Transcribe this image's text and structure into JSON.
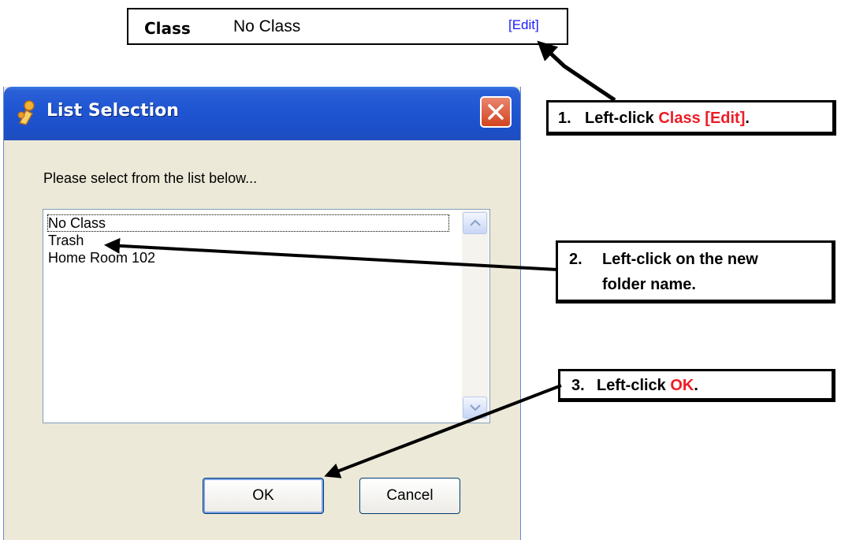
{
  "class_field": {
    "label": "Class",
    "value": "No Class",
    "edit": "[Edit]"
  },
  "dialog": {
    "title": "List Selection",
    "prompt": "Please select from the list below...",
    "items": [
      "No Class",
      "Trash",
      "Home Room 102"
    ],
    "ok": "OK",
    "cancel": "Cancel"
  },
  "callouts": {
    "step1": {
      "num": "1.",
      "pre": "Left-click ",
      "highlight": "Class [Edit]",
      "post": "."
    },
    "step2": {
      "num": "2.",
      "line1": "Left-click on the new",
      "line2": "folder name."
    },
    "step3": {
      "num": "3.",
      "pre": "Left-click ",
      "highlight": "OK",
      "post": "."
    }
  },
  "colors": {
    "highlight": "#ee1c25",
    "title_bar": "#1f55d2",
    "link": "#1a1aff",
    "dialog_bg": "#ece9d8"
  }
}
